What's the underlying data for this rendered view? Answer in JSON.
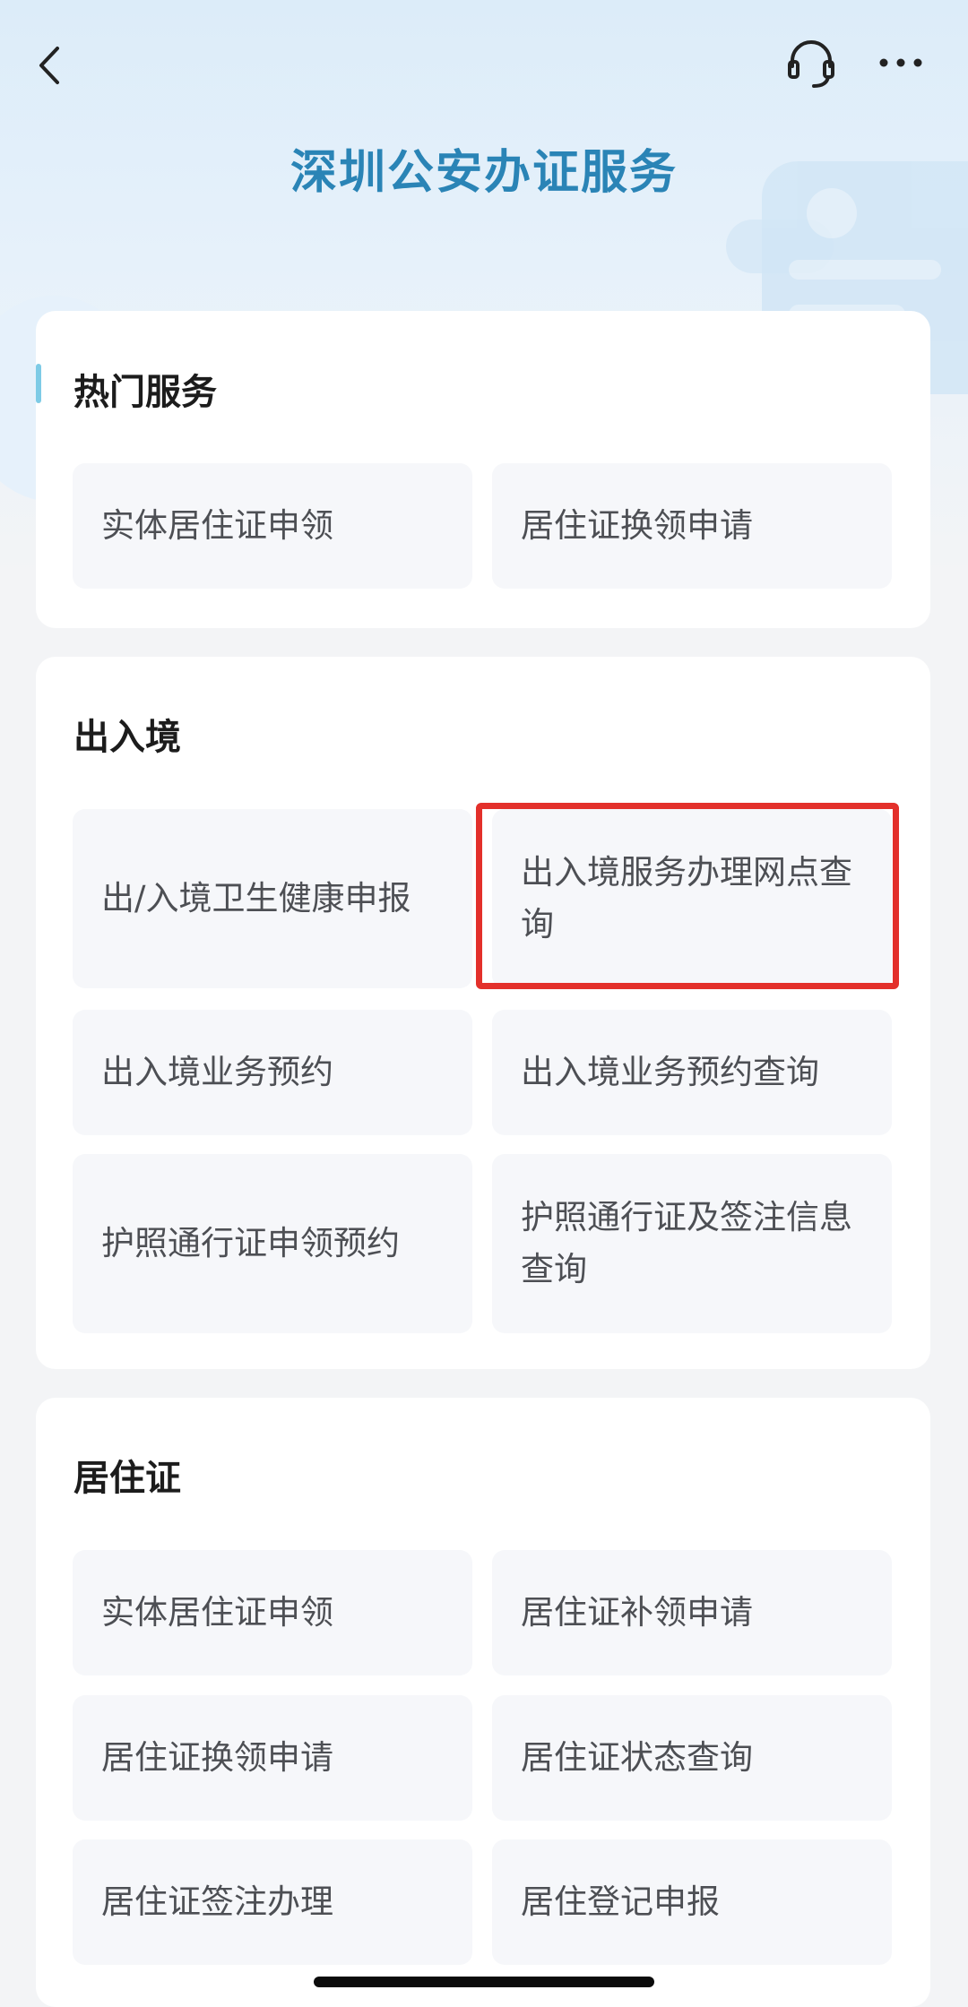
{
  "header": {
    "title": "深圳公安办证服务",
    "back_icon": "chevron-left-icon",
    "support_icon": "headset-icon",
    "more_icon": "more-horizontal-icon"
  },
  "colors": {
    "title": "#2a84b6",
    "accent_bar": "#7ecbe6",
    "highlight": "#e3302b"
  },
  "sections": [
    {
      "title": "热门服务",
      "items": [
        {
          "label": "实体居住证申领"
        },
        {
          "label": "居住证换领申请"
        }
      ]
    },
    {
      "title": "出入境",
      "items": [
        {
          "label": "出/入境卫生健康申报"
        },
        {
          "label": "出入境服务办理网点查询",
          "highlighted": true
        },
        {
          "label": "出入境业务预约"
        },
        {
          "label": "出入境业务预约查询"
        },
        {
          "label": "护照通行证申领预约"
        },
        {
          "label": "护照通行证及签注信息查询"
        }
      ]
    },
    {
      "title": "居住证",
      "items": [
        {
          "label": "实体居住证申领"
        },
        {
          "label": "居住证补领申请"
        },
        {
          "label": "居住证换领申请"
        },
        {
          "label": "居住证状态查询"
        },
        {
          "label": "居住证签注办理"
        },
        {
          "label": "居住登记申报"
        }
      ]
    }
  ]
}
